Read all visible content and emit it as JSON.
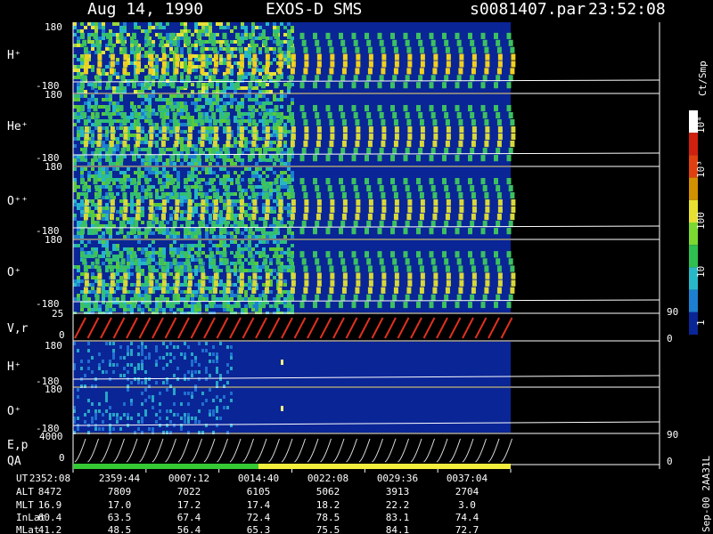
{
  "header": {
    "date": "Aug 14, 1990",
    "mission": "EXOS-D SMS",
    "file": "s0081407.par",
    "time": "23:52:08"
  },
  "panels": [
    {
      "label": "H⁺",
      "top": "180",
      "bottom": "-180"
    },
    {
      "label": "He⁺",
      "top": "180",
      "bottom": "-180"
    },
    {
      "label": "O⁺⁺",
      "top": "180",
      "bottom": "-180"
    },
    {
      "label": "O⁺",
      "top": "180",
      "bottom": "-180"
    },
    {
      "label": "V,r",
      "top": "25",
      "bottom": "0"
    },
    {
      "label": "H⁺",
      "top": "180",
      "bottom": "-180"
    },
    {
      "label": "O⁺",
      "top": "180",
      "bottom": "-180"
    },
    {
      "label": "E,p",
      "top": "4000",
      "bottom": "0"
    }
  ],
  "qa_label": "QA",
  "right_axes": {
    "vr": {
      "top": "90",
      "bottom": "0"
    },
    "ep": {
      "top": "90",
      "bottom": "0"
    }
  },
  "colorbar": {
    "unit": "Ct/Smp",
    "labels": [
      "10⁴",
      "10³",
      "100",
      "10",
      "1"
    ]
  },
  "table": {
    "rows": [
      {
        "label": "UT",
        "values": [
          "2352:08",
          "2359:44",
          "0007:12",
          "0014:40",
          "0022:08",
          "0029:36",
          "0037:04"
        ]
      },
      {
        "label": "ALT",
        "values": [
          "8472",
          "7809",
          "7022",
          "6105",
          "5062",
          "3913",
          "2704"
        ]
      },
      {
        "label": "MLT",
        "values": [
          "16.9",
          "17.0",
          "17.2",
          "17.4",
          "18.2",
          "22.2",
          "3.0"
        ]
      },
      {
        "label": "InLat",
        "values": [
          "60.4",
          "63.5",
          "67.4",
          "72.4",
          "78.5",
          "83.1",
          "74.4"
        ]
      },
      {
        "label": "MLat",
        "values": [
          "41.2",
          "48.5",
          "56.4",
          "65.3",
          "75.5",
          "84.1",
          "72.7"
        ]
      }
    ]
  },
  "footer_code": "Sep-00 2AA31L",
  "colors": {
    "background": "#000000",
    "plot_fill": "#0a2596",
    "qa_good": "#35c935",
    "qa_mid": "#f3ee3c"
  },
  "chart_data": {
    "type": "heatmap",
    "x_ticks": [
      "2352:08",
      "2359:44",
      "0007:12",
      "0014:40",
      "0022:08",
      "0029:36",
      "0037:04"
    ],
    "ion_pitch_panels": [
      "H⁺",
      "He⁺",
      "O⁺⁺",
      "O⁺"
    ],
    "pitch_range": [
      -180,
      180
    ],
    "lower_panels": [
      "V,r",
      "H⁺",
      "O⁺",
      "E,p"
    ],
    "vr_range": [
      0,
      25
    ],
    "ep_range": [
      0,
      4000
    ],
    "colorbar_scale": "log",
    "colorbar_range": [
      1,
      10000
    ]
  }
}
